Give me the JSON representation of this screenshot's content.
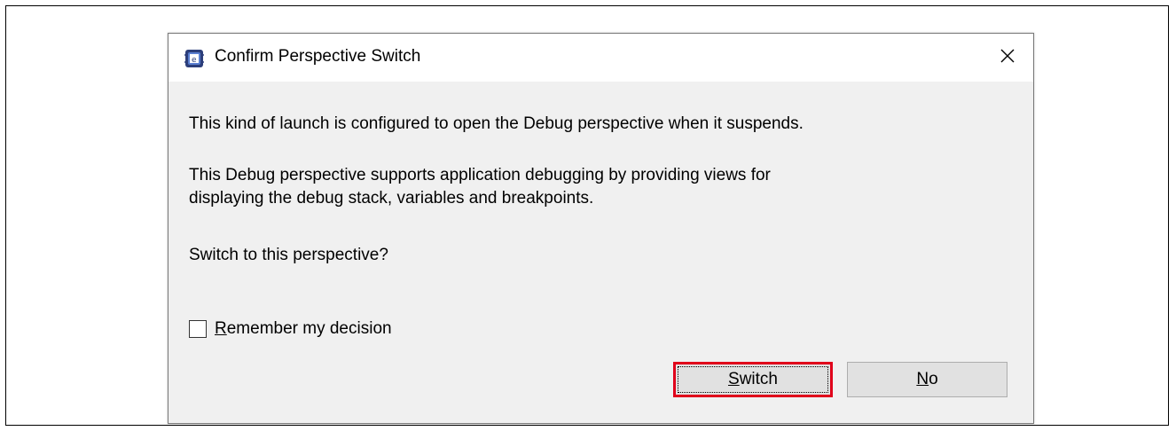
{
  "dialog": {
    "title": "Confirm Perspective Switch",
    "app_icon": "eclipse-ide-icon",
    "close_icon": "close-icon",
    "message_line1": "This kind of launch is configured to open the Debug perspective when it suspends.",
    "message_line2": "This Debug perspective supports application debugging by providing views for displaying the debug stack, variables and breakpoints.",
    "message_question": "Switch to this perspective?",
    "remember": {
      "mnemonic": "R",
      "rest": "emember my decision",
      "checked": false
    },
    "buttons": {
      "switch": {
        "mnemonic": "S",
        "rest": "witch",
        "highlighted": true
      },
      "no": {
        "mnemonic": "N",
        "rest": "o"
      }
    },
    "highlight_color": "#e0001b"
  }
}
